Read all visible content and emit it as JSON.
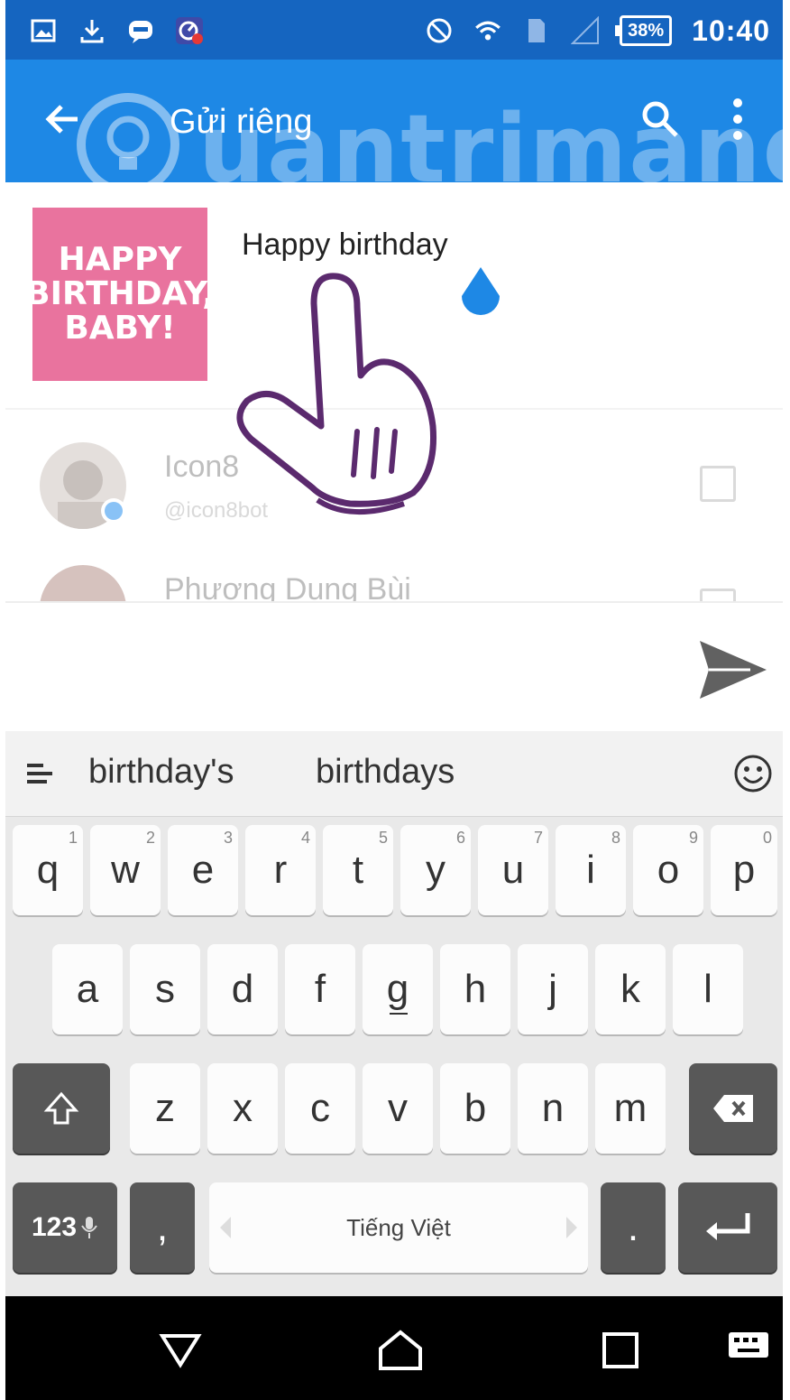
{
  "status_bar": {
    "battery": "38%",
    "time": "10:40",
    "icons": [
      "gallery-icon",
      "download-icon",
      "zalo-icon",
      "speedometer-icon",
      "do-not-disturb-icon",
      "wifi-icon",
      "sim-icon",
      "signal-icon",
      "battery-icon"
    ]
  },
  "app_bar": {
    "title": "Gửi riêng",
    "icons": [
      "back-arrow-icon",
      "search-icon",
      "more-vert-icon"
    ],
    "background": "#1e88e5"
  },
  "watermark": "uantrimang",
  "compose": {
    "card_text": [
      "HAPPY",
      "BIRTHDAY,",
      "BABY!"
    ],
    "message": "Happy birthday",
    "handle_color": "#1e88e5"
  },
  "contacts": [
    {
      "name": "Icon8",
      "handle": "@icon8bot"
    },
    {
      "name": "Phương Dung Bùi",
      "handle": ""
    }
  ],
  "keyboard": {
    "suggestions": [
      "birthday's",
      "birthdays"
    ],
    "row1": [
      {
        "key": "q",
        "hint": "1"
      },
      {
        "key": "w",
        "hint": "2"
      },
      {
        "key": "e",
        "hint": "3"
      },
      {
        "key": "r",
        "hint": "4"
      },
      {
        "key": "t",
        "hint": "5"
      },
      {
        "key": "y",
        "hint": "6"
      },
      {
        "key": "u",
        "hint": "7"
      },
      {
        "key": "i",
        "hint": "8"
      },
      {
        "key": "o",
        "hint": "9"
      },
      {
        "key": "p",
        "hint": "0"
      }
    ],
    "row2": [
      "a",
      "s",
      "d",
      "f",
      "g",
      "h",
      "j",
      "k",
      "l"
    ],
    "row3": [
      "z",
      "x",
      "c",
      "v",
      "b",
      "n",
      "m"
    ],
    "num_key": "123",
    "comma_key": ",",
    "space_label": "Tiếng Việt",
    "period_key": "."
  },
  "nav_bar": {
    "icons": [
      "back-triangle-icon",
      "home-icon",
      "recents-icon",
      "keyboard-icon"
    ]
  }
}
